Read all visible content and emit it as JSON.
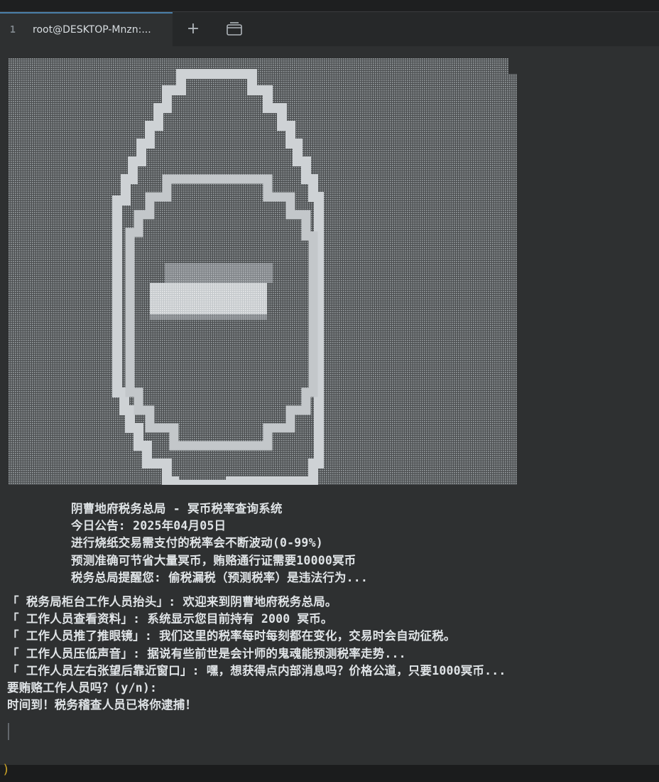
{
  "tabs": [
    {
      "index": "1",
      "title": "root@DESKTOP-Mnzn:..."
    }
  ],
  "new_tab_symbol": "+",
  "icons": {
    "new_tab": "plus-icon",
    "tabs_view": "tabs-overview-icon"
  },
  "colors": {
    "background": "#2e3031",
    "text": "#dfe3e6",
    "tab_bar": "#262829",
    "accent": "#c9a227"
  },
  "terminal": {
    "header": [
      "阴曹地府税务总局 - 冥币税率查询系统",
      "今日公告: 2025年04月05日",
      "进行烧纸交易需支付的税率会不断波动(0-99%)",
      "预测准确可节省大量冥币，贿赂通行证需要10000冥币",
      "税务总局提醒您: 偷税漏税（预测税率）是违法行为..."
    ],
    "dialogue": [
      "「 税务局柜台工作人员抬头」: 欢迎来到阴曹地府税务总局。",
      "「 工作人员查看资料」: 系统显示您目前持有 2000 冥币。",
      "「 工作人员推了推眼镜」: 我们这里的税率每时每刻都在变化，交易时会自动征税。",
      "「 工作人员压低声音」: 据说有些前世是会计师的鬼魂能预测税率走势...",
      "「 工作人员左右张望后靠近窗口」: 嘿，想获得点内部消息吗？价格公道，只要1000冥币..."
    ],
    "prompt": "要贿赂工作人员吗？(y/n):",
    "result": "时间到！税务稽查人员已将你逮捕！"
  },
  "status_glyph": ")"
}
